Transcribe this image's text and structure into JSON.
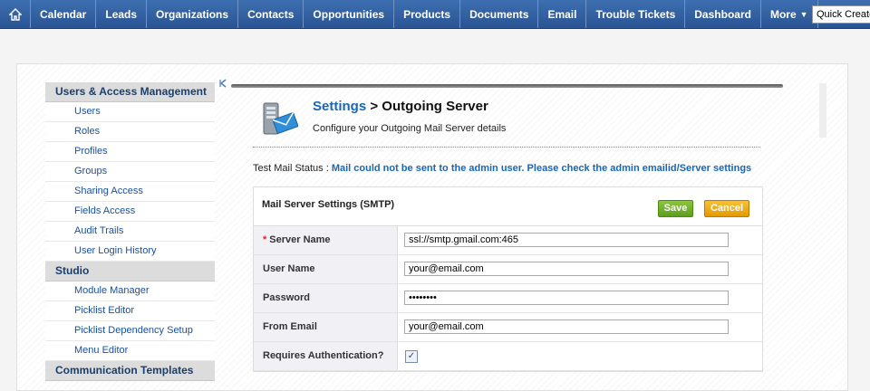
{
  "nav": {
    "items": [
      "Calendar",
      "Leads",
      "Organizations",
      "Contacts",
      "Opportunities",
      "Products",
      "Documents",
      "Email",
      "Trouble Tickets",
      "Dashboard"
    ],
    "more_label": "More",
    "quick_create": "Quick Create"
  },
  "sidebar": {
    "sections": [
      {
        "heading": "Users & Access Management",
        "items": [
          "Users",
          "Roles",
          "Profiles",
          "Groups",
          "Sharing Access",
          "Fields Access",
          "Audit Trails",
          "User Login History"
        ]
      },
      {
        "heading": "Studio",
        "items": [
          "Module Manager",
          "Picklist Editor",
          "Picklist Dependency Setup",
          "Menu Editor"
        ]
      },
      {
        "heading": "Communication Templates",
        "items": []
      }
    ]
  },
  "page": {
    "title_link": "Settings",
    "title_sep": " > ",
    "title_rest": "Outgoing Server",
    "subtitle": "Configure your Outgoing Mail Server details",
    "status_label": "Test Mail Status : ",
    "status_msg": "Mail could not be sent to the admin user. Please check the admin emailid/Server settings"
  },
  "form": {
    "heading": "Mail Server Settings (SMTP)",
    "save_label": "Save",
    "cancel_label": "Cancel",
    "server_name_label": "Server Name",
    "server_name_value": "ssl://smtp.gmail.com:465",
    "user_name_label": "User Name",
    "user_name_value": "your@email.com",
    "password_label": "Password",
    "password_value": "password",
    "from_email_label": "From Email",
    "from_email_value": "your@email.com",
    "auth_label": "Requires Authentication?",
    "auth_checked": true
  }
}
